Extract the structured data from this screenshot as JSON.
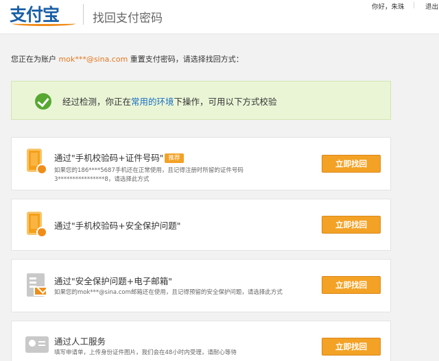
{
  "header": {
    "logo_text": "支付宝",
    "title": "找回支付密码",
    "greeting": "你好，朱珠",
    "separator": "|",
    "logout": "退出"
  },
  "intro": {
    "prefix": "您正在为账户 ",
    "account": "mok***@sina.com",
    "suffix": " 重置支付密码，请选择找回方式："
  },
  "notice": {
    "before": "经过检测，你正在",
    "env": "常用的环境",
    "after": "下操作，可用以下方式校验"
  },
  "options": [
    {
      "icon": "phone-icon",
      "title": "通过\"手机校验码+证件号码\"",
      "badge": "推荐",
      "desc": "如果您的186****5687手机还在正常使用，且记得注册时所留的证件号码3****************8，请选择此方式",
      "button": "立即找回"
    },
    {
      "icon": "phone-icon",
      "title": "通过\"手机校验码+安全保护问题\"",
      "badge": "",
      "desc": "",
      "button": "立即找回"
    },
    {
      "icon": "mail-icon",
      "title": "通过\"安全保护问题+电子邮箱\"",
      "badge": "",
      "desc": "如果您的mok***@sina.com邮箱还在使用，且记得预留的安全保护问题，请选择此方式",
      "button": "立即找回"
    },
    {
      "icon": "id-card-icon",
      "title": "通过人工服务",
      "badge": "",
      "desc": "填写申请单，上传身份证件图片，我们会在48小时内受理，请耐心等待",
      "button": "立即找回"
    }
  ],
  "colors": {
    "accent_orange": "#f3a225",
    "link_blue": "#1a6fc0",
    "account_orange": "#e2781e",
    "notice_bg": "#eaf5d6",
    "check_green": "#57a832"
  }
}
